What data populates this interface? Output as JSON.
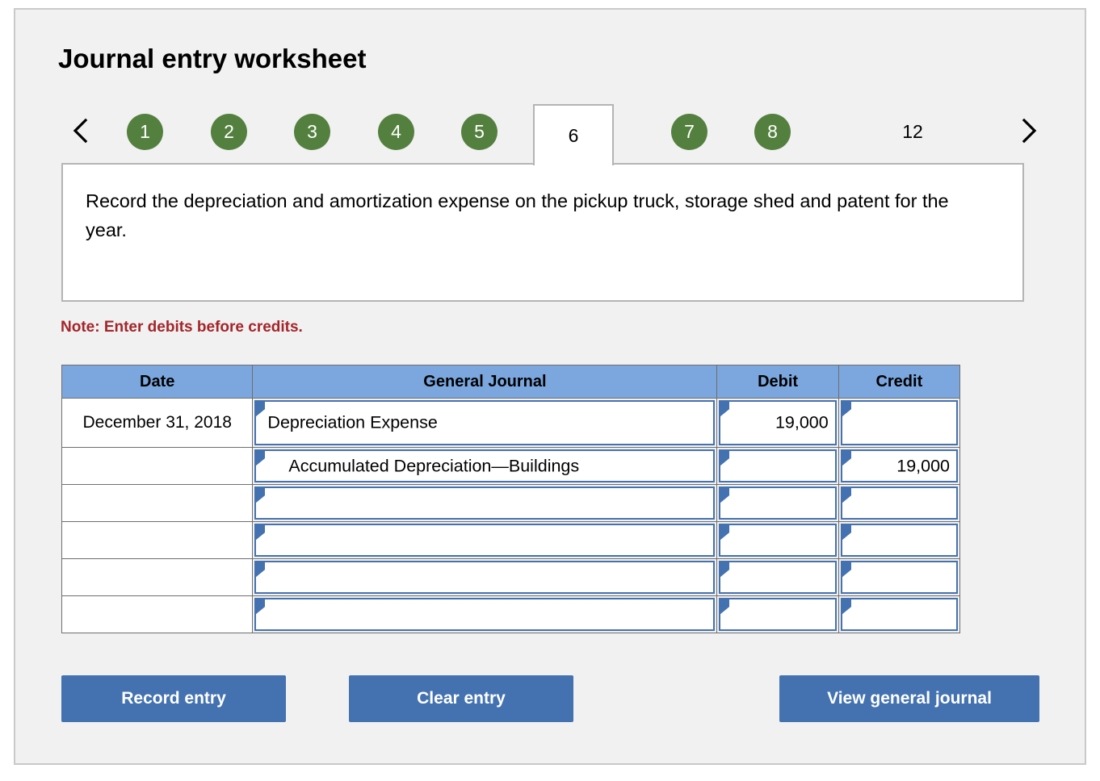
{
  "header": {
    "title": "Journal entry worksheet"
  },
  "tabs": {
    "prev_icon": "chevron-left-icon",
    "next_icon": "chevron-right-icon",
    "items": [
      {
        "label": "1",
        "state": "normal"
      },
      {
        "label": "2",
        "state": "normal"
      },
      {
        "label": "3",
        "state": "normal"
      },
      {
        "label": "4",
        "state": "normal"
      },
      {
        "label": "5",
        "state": "normal"
      },
      {
        "label": "6",
        "state": "active"
      },
      {
        "label": "7",
        "state": "normal"
      },
      {
        "label": "8",
        "state": "normal"
      },
      {
        "label": "12",
        "state": "plain"
      }
    ],
    "accent_color": "#54803f"
  },
  "instruction": {
    "text": "Record the depreciation and amortization expense on the pickup truck, storage shed and patent for the year."
  },
  "note": {
    "text": "Note: Enter debits before credits.",
    "color": "#a4252a"
  },
  "table": {
    "header_color": "#7ba7de",
    "columns": [
      "Date",
      "General Journal",
      "Debit",
      "Credit"
    ],
    "rows": [
      {
        "date": "December 31, 2018",
        "account": "Depreciation Expense",
        "indent": false,
        "debit": "19,000",
        "credit": ""
      },
      {
        "date": "",
        "account": "Accumulated Depreciation—Buildings",
        "indent": true,
        "debit": "",
        "credit": "19,000"
      },
      {
        "date": "",
        "account": "",
        "indent": false,
        "debit": "",
        "credit": ""
      },
      {
        "date": "",
        "account": "",
        "indent": false,
        "debit": "",
        "credit": ""
      },
      {
        "date": "",
        "account": "",
        "indent": false,
        "debit": "",
        "credit": ""
      },
      {
        "date": "",
        "account": "",
        "indent": false,
        "debit": "",
        "credit": ""
      }
    ]
  },
  "buttons": {
    "record": "Record entry",
    "clear": "Clear entry",
    "view": "View general journal",
    "color": "#4472b0"
  }
}
